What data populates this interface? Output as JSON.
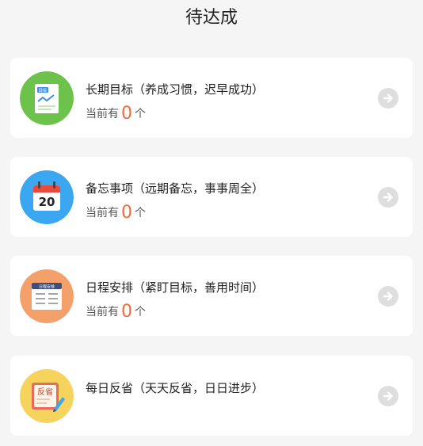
{
  "header": {
    "title": "待达成"
  },
  "cards": [
    {
      "title": "长期目标（养成习惯，迟早成功）",
      "count_prefix": "当前有",
      "count": "0",
      "count_suffix": "个",
      "icon": "goal-document-icon",
      "icon_bg": "#6cc24a"
    },
    {
      "title": "备忘事项（远期备忘，事事周全）",
      "count_prefix": "当前有",
      "count": "0",
      "count_suffix": "个",
      "icon": "calendar-icon",
      "calendar_day": "20",
      "icon_bg": "#3aa7f0"
    },
    {
      "title": "日程安排（紧盯目标，善用时间）",
      "count_prefix": "当前有",
      "count": "0",
      "count_suffix": "个",
      "icon": "schedule-board-icon",
      "icon_bg": "#f4a06b"
    },
    {
      "title": "每日反省（天天反省，日日进步）",
      "icon": "reflection-note-icon",
      "icon_bg": "#f6d35c"
    }
  ],
  "icon_labels": {
    "goal": "目标",
    "schedule": "日程安排",
    "reflection": "反省"
  },
  "colors": {
    "count_accent": "#f26a3c",
    "arrow_bg": "#dedede"
  }
}
